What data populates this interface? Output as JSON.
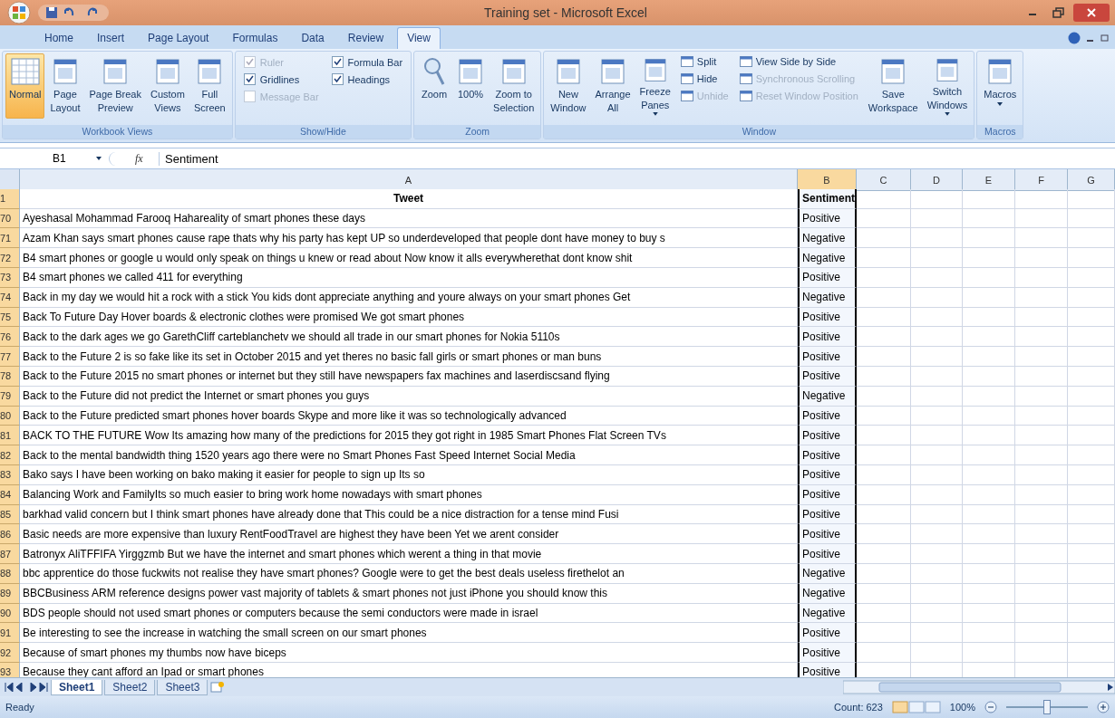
{
  "window": {
    "title": "Training set - Microsoft Excel"
  },
  "tabs": [
    {
      "label": "Home",
      "selected": false
    },
    {
      "label": "Insert",
      "selected": false
    },
    {
      "label": "Page Layout",
      "selected": false
    },
    {
      "label": "Formulas",
      "selected": false
    },
    {
      "label": "Data",
      "selected": false
    },
    {
      "label": "Review",
      "selected": false
    },
    {
      "label": "View",
      "selected": true
    }
  ],
  "ribbon": {
    "groups": [
      {
        "label": "Workbook Views",
        "items": [
          {
            "kind": "large",
            "lines": [
              "Normal"
            ],
            "selected": true,
            "dropdown": false
          },
          {
            "kind": "large",
            "lines": [
              "Page",
              "Layout"
            ],
            "selected": false,
            "dropdown": false
          },
          {
            "kind": "large",
            "lines": [
              "Page Break",
              "Preview"
            ],
            "selected": false,
            "dropdown": false
          },
          {
            "kind": "large",
            "lines": [
              "Custom",
              "Views"
            ],
            "selected": false,
            "dropdown": false
          },
          {
            "kind": "large",
            "lines": [
              "Full",
              "Screen"
            ],
            "selected": false,
            "dropdown": false
          }
        ]
      },
      {
        "label": "Show/Hide",
        "items": [
          {
            "kind": "checks",
            "checks": [
              {
                "label": "Ruler",
                "checked": true,
                "disabled": true
              },
              {
                "label": "Gridlines",
                "checked": true,
                "disabled": false
              },
              {
                "label": "Message Bar",
                "checked": false,
                "disabled": true
              }
            ]
          },
          {
            "kind": "checks",
            "checks": [
              {
                "label": "Formula Bar",
                "checked": true,
                "disabled": false
              },
              {
                "label": "Headings",
                "checked": true,
                "disabled": false
              }
            ]
          }
        ]
      },
      {
        "label": "Zoom",
        "items": [
          {
            "kind": "large",
            "lines": [
              "Zoom"
            ],
            "selected": false,
            "dropdown": false
          },
          {
            "kind": "large",
            "lines": [
              "100%"
            ],
            "selected": false,
            "dropdown": false
          },
          {
            "kind": "large",
            "lines": [
              "Zoom to",
              "Selection"
            ],
            "selected": false,
            "dropdown": false
          }
        ]
      },
      {
        "label": "Window",
        "items": [
          {
            "kind": "large",
            "lines": [
              "New",
              "Window"
            ],
            "selected": false,
            "dropdown": false
          },
          {
            "kind": "large",
            "lines": [
              "Arrange",
              "All"
            ],
            "selected": false,
            "dropdown": false
          },
          {
            "kind": "large",
            "lines": [
              "Freeze",
              "Panes"
            ],
            "selected": false,
            "dropdown": true
          },
          {
            "kind": "smalls",
            "smalls": [
              {
                "label": "Split",
                "disabled": false
              },
              {
                "label": "Hide",
                "disabled": false
              },
              {
                "label": "Unhide",
                "disabled": true
              }
            ]
          },
          {
            "kind": "smalls",
            "smalls": [
              {
                "label": "View Side by Side",
                "disabled": false
              },
              {
                "label": "Synchronous Scrolling",
                "disabled": true
              },
              {
                "label": "Reset Window Position",
                "disabled": true
              }
            ]
          },
          {
            "kind": "large",
            "lines": [
              "Save",
              "Workspace"
            ],
            "selected": false,
            "dropdown": false
          },
          {
            "kind": "large",
            "lines": [
              "Switch",
              "Windows"
            ],
            "selected": false,
            "dropdown": true
          }
        ]
      },
      {
        "label": "Macros",
        "items": [
          {
            "kind": "large",
            "lines": [
              "Macros"
            ],
            "selected": false,
            "dropdown": true
          }
        ]
      }
    ]
  },
  "formula_bar": {
    "name_box": "B1",
    "fx": "fx",
    "value": "Sentiment"
  },
  "columns": [
    {
      "label": "A",
      "selected": false
    },
    {
      "label": "B",
      "selected": true
    },
    {
      "label": "C",
      "selected": false
    },
    {
      "label": "D",
      "selected": false
    },
    {
      "label": "E",
      "selected": false
    },
    {
      "label": "F",
      "selected": false
    },
    {
      "label": "G",
      "selected": false
    }
  ],
  "header_row": {
    "number": "1",
    "tweet": "Tweet",
    "sentiment": "Sentiment"
  },
  "rows": [
    {
      "number": "70",
      "tweet": "Ayeshasal Mohammad Farooq Hahareality of smart phones these days",
      "sentiment": "Positive"
    },
    {
      "number": "71",
      "tweet": "Azam Khan says smart phones cause rape thats why his party has kept UP so underdeveloped that people dont have money to buy s",
      "sentiment": "Negative"
    },
    {
      "number": "72",
      "tweet": "B4 smart phones or google u would only speak on things u knew or read about Now know it alls everywherethat dont know shit",
      "sentiment": "Negative"
    },
    {
      "number": "73",
      "tweet": "B4 smart phones we called 411 for everything",
      "sentiment": "Positive"
    },
    {
      "number": "74",
      "tweet": "Back in my day we would hit a rock with a stick You kids dont appreciate anything and youre always on your smart phones Get",
      "sentiment": "Negative"
    },
    {
      "number": "75",
      "tweet": "Back To Future Day Hover boards & electronic clothes were promised We got smart phones",
      "sentiment": "Positive"
    },
    {
      "number": "76",
      "tweet": "Back to the dark ages we go GarethCliff carteblanchetv we should all trade in our smart phones for Nokia 5110s",
      "sentiment": "Positive"
    },
    {
      "number": "77",
      "tweet": "Back to the Future 2 is so fake like its set in October 2015 and yet theres no basic fall girls or smart phones or man buns",
      "sentiment": "Positive"
    },
    {
      "number": "78",
      "tweet": "Back to the Future 2015 no smart phones or internet but they still have newspapers fax machines and laserdiscsand flying",
      "sentiment": "Positive"
    },
    {
      "number": "79",
      "tweet": "Back to the Future did not predict the Internet or smart phones you guys",
      "sentiment": "Negative"
    },
    {
      "number": "80",
      "tweet": "Back to the Future predicted smart phones hover boards Skype and more like it was so technologically advanced",
      "sentiment": "Positive"
    },
    {
      "number": "81",
      "tweet": "BACK TO THE FUTURE Wow Its amazing how many of the predictions for 2015 they got right in 1985 Smart Phones Flat Screen TVs",
      "sentiment": "Positive"
    },
    {
      "number": "82",
      "tweet": "Back to the mental bandwidth thing 1520 years ago there were no  Smart Phones Fast Speed Internet Social Media",
      "sentiment": "Positive"
    },
    {
      "number": "83",
      "tweet": "Bako says I have been working on bako making it easier for people to sign up Its so",
      "sentiment": "Positive"
    },
    {
      "number": "84",
      "tweet": "Balancing Work and FamilyIts so much easier to bring work home nowadays with smart phones",
      "sentiment": "Positive"
    },
    {
      "number": "85",
      "tweet": "barkhad valid concern but I think smart phones have already done that This could be a nice distraction for a tense mind  Fusi",
      "sentiment": "Positive"
    },
    {
      "number": "86",
      "tweet": "Basic needs are more expensive than luxury RentFoodTravel are highest they have been Yet we arent consider",
      "sentiment": "Positive"
    },
    {
      "number": "87",
      "tweet": "Batronyx AliTFFIFA Yirggzmb But we have the internet and smart phones which werent a thing in that movie",
      "sentiment": "Positive"
    },
    {
      "number": "88",
      "tweet": "bbc apprentice do those fuckwits not realise they have smart phones? Google were to get the best deals useless firethelot an",
      "sentiment": "Negative"
    },
    {
      "number": "89",
      "tweet": "BBCBusiness ARM reference designs power vast majority of tablets & smart phones not just iPhone you should know this",
      "sentiment": "Negative"
    },
    {
      "number": "90",
      "tweet": "BDS people should not used smart phones or computers because the semi conductors were made in israel",
      "sentiment": "Negative"
    },
    {
      "number": "91",
      "tweet": "Be interesting to see the increase in watching the small screen on our smart phones",
      "sentiment": "Positive"
    },
    {
      "number": "92",
      "tweet": "Because of smart phones my thumbs now have biceps",
      "sentiment": "Positive"
    },
    {
      "number": "93",
      "tweet": "Because they cant afford an Ipad or smart phones",
      "sentiment": "Positive"
    }
  ],
  "sheets": [
    {
      "label": "Sheet1",
      "selected": true
    },
    {
      "label": "Sheet2",
      "selected": false
    },
    {
      "label": "Sheet3",
      "selected": false
    }
  ],
  "status_bar": {
    "state": "Ready",
    "count": "Count: 623",
    "zoom": "100%",
    "zoom_slider": {
      "level": 0.5
    }
  }
}
